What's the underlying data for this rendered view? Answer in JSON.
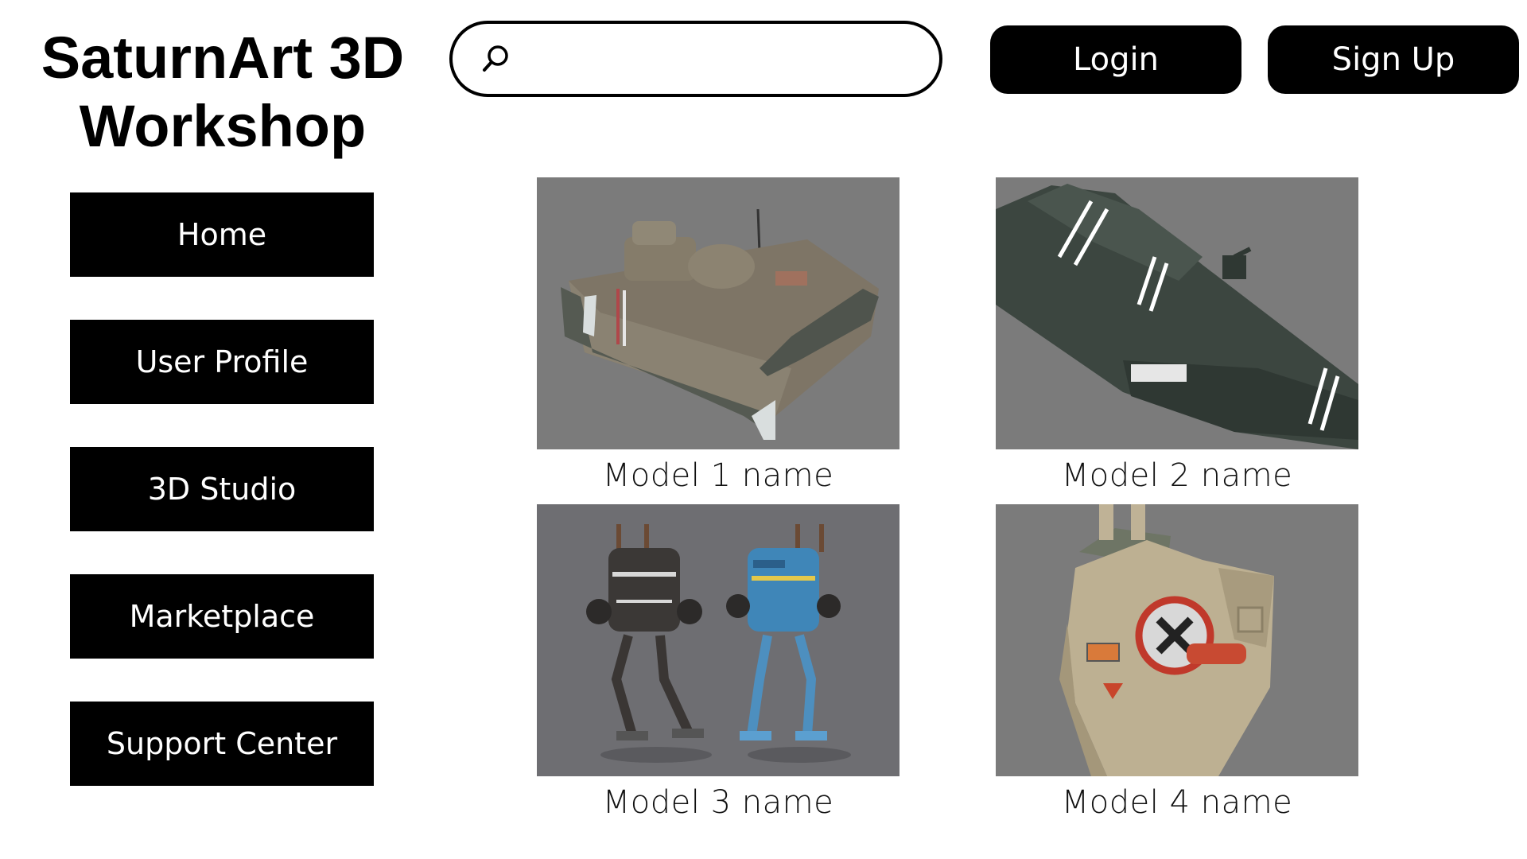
{
  "brand": {
    "line1": "SaturnArt 3D",
    "line2": "Workshop"
  },
  "search": {
    "value": "",
    "placeholder": "",
    "icon": "search-icon"
  },
  "header": {
    "login_label": "Login",
    "signup_label": "Sign Up"
  },
  "sidebar": {
    "items": [
      {
        "label": "Home"
      },
      {
        "label": "User Profile"
      },
      {
        "label": "3D Studio"
      },
      {
        "label": "Marketplace"
      },
      {
        "label": "Support Center"
      }
    ]
  },
  "models": [
    {
      "name": "Model 1 name",
      "subject": "tank"
    },
    {
      "name": "Model 2 name",
      "subject": "spaceship"
    },
    {
      "name": "Model 3 name",
      "subject": "walker-robots"
    },
    {
      "name": "Model 4 name",
      "subject": "mech"
    }
  ],
  "colors": {
    "button_bg": "#000000",
    "button_text": "#ffffff",
    "thumb_bg": "#7b7b7b"
  }
}
